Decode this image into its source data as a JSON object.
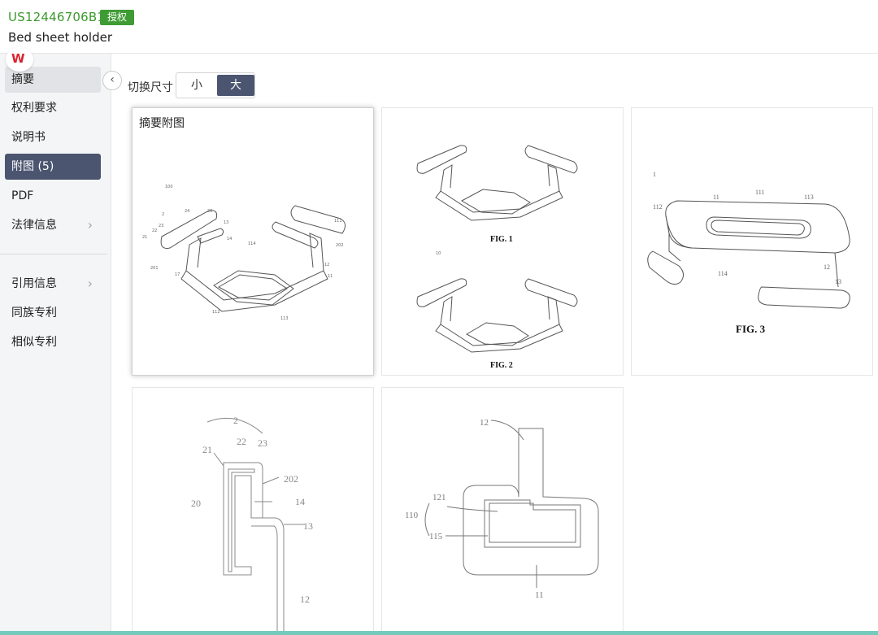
{
  "header": {
    "patent_number": "US12446706B1",
    "status_badge": "授权",
    "title": "Bed sheet holder"
  },
  "logo": {
    "text": "W"
  },
  "sidebar": {
    "collapse_icon": "chevron-left-icon",
    "items": [
      {
        "label": "摘要",
        "state": "hover"
      },
      {
        "label": "权利要求"
      },
      {
        "label": "说明书"
      },
      {
        "label": "附图 (5)",
        "state": "active"
      },
      {
        "label": "PDF"
      },
      {
        "label": "法律信息",
        "has_arrow": true
      },
      {
        "label": "引用信息",
        "has_arrow": true
      },
      {
        "label": "同族专利"
      },
      {
        "label": "相似专利"
      }
    ]
  },
  "toolbar": {
    "size_label": "切换尺寸",
    "size_options": [
      "小",
      "大"
    ],
    "selected_size": "大"
  },
  "gallery": {
    "abstract_label": "摘要附图",
    "figures": [
      {
        "id": "abstract",
        "labels": [
          "100",
          "24",
          "2",
          "23",
          "22",
          "21",
          "20",
          "201",
          "202",
          "14",
          "114",
          "13",
          "12",
          "11",
          "17",
          "113",
          "112",
          "111"
        ]
      },
      {
        "id": "fig1",
        "caption": "FIG. 1",
        "sub_label": "10"
      },
      {
        "id": "fig3",
        "caption": "FIG. 3",
        "labels": [
          "1",
          "11",
          "111",
          "112",
          "113",
          "12",
          "13",
          "114"
        ]
      },
      {
        "id": "fig4",
        "labels": [
          "2",
          "21",
          "22",
          "23",
          "202",
          "20",
          "14",
          "13",
          "12"
        ]
      },
      {
        "id": "fig5",
        "labels": [
          "12",
          "121",
          "110",
          "115",
          "11"
        ]
      }
    ],
    "fig2_caption": "FIG. 2"
  },
  "colors": {
    "brand_green": "#3a9a2c",
    "badge_green": "#3f9c35",
    "active_nav": "#4b5570",
    "bottom_bar": "#74cbbd"
  }
}
